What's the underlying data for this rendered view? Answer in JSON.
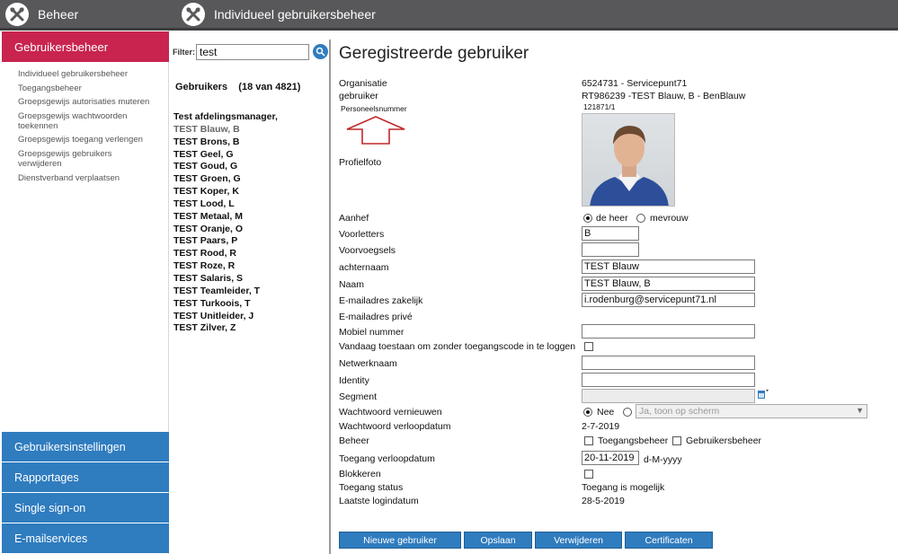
{
  "topbar": {
    "left_title": "Beheer",
    "right_title": "Individueel gebruikersbeheer",
    "icon": "tools-icon"
  },
  "leftnav": {
    "active": "Gebruikersbeheer",
    "subitems": [
      "Individueel gebruikersbeheer",
      "Toegangsbeheer",
      "Groepsgewijs autorisaties muteren",
      "Groepsgewijs wachtwoorden",
      "toekennen",
      "Groepsgewijs toegang verlengen",
      "Groepsgewijs gebruikers",
      "verwijderen",
      "Dienstverband verplaatsen"
    ],
    "sections": [
      "Gebruikersinstellingen",
      "Rapportages",
      "Single sign-on",
      "E-mailservices"
    ]
  },
  "filter": {
    "label": "Filter:",
    "value": "test",
    "button_icon": "search-icon"
  },
  "users": {
    "heading": "Gebruikers    (18 van 4821)",
    "items": [
      "Test afdelingsmanager,",
      "TEST Blauw, B",
      "TEST Brons, B",
      "TEST Geel, G",
      "TEST Goud, G",
      "TEST Groen, G",
      "TEST Koper, K",
      "TEST Lood, L",
      "TEST Metaal, M",
      "TEST Oranje, O",
      "TEST Paars, P",
      "TEST Rood, R",
      "TEST Roze, R",
      "TEST Salaris, S",
      "TEST Teamleider, T",
      "TEST Turkoois, T",
      "TEST Unitleider, J",
      "TEST Zilver, Z"
    ],
    "selected_index": 1
  },
  "main": {
    "title": "Geregistreerde gebruiker",
    "organisatie_label": "Organisatie",
    "organisatie_value": "6524731 - Servicepunt71",
    "gebruiker_label": "gebruiker",
    "gebruiker_value": "RT986239 -TEST Blauw, B  - BenBlauw",
    "personeelsnummer_label": "Personeelsnummer",
    "personeelsnummer_value": "121871/1",
    "profielfoto_label": "Profielfoto",
    "aanhef_label": "Aanhef",
    "aanhef_options": [
      "de heer",
      "mevrouw"
    ],
    "voorletters_label": "Voorletters",
    "voorletters_value": "B",
    "voorvoegsels_label": "Voorvoegsels",
    "voorvoegsels_value": "",
    "achternaam_label": "achternaam",
    "achternaam_value": "TEST Blauw",
    "naam_label": "Naam",
    "naam_value": "TEST Blauw, B",
    "email_zakelijk_label": "E-mailadres zakelijk",
    "email_zakelijk_value": "i.rodenburg@servicepunt71.nl",
    "email_prive_label": "E-mailadres privé",
    "mobiel_label": "Mobiel nummer",
    "mobiel_value": "",
    "vandaag_label": "Vandaag toestaan om zonder toegangscode in te loggen",
    "netwerknaam_label": "Netwerknaam",
    "netwerknaam_value": "",
    "identity_label": "Identity",
    "identity_value": "",
    "segment_label": "Segment",
    "segment_value": "",
    "ww_vernieuwen_label": "Wachtwoord vernieuwen",
    "ww_nee": "Nee",
    "ww_select": "Ja, toon op scherm",
    "ww_verloop_label": "Wachtwoord verloopdatum",
    "ww_verloop_value": "2-7-2019",
    "beheer_label": "Beheer",
    "beheer_opt1": "Toegangsbeheer",
    "beheer_opt2": "Gebruikersbeheer",
    "toegang_verloop_label": "Toegang verloopdatum",
    "toegang_verloop_value": "20-11-2019",
    "toegang_verloop_format": "d-M-yyyy",
    "blokkeren_label": "Blokkeren",
    "toegang_status_label": "Toegang status",
    "toegang_status_value": "Toegang is mogelijk",
    "laatste_login_label": "Laatste logindatum",
    "laatste_login_value": "28-5-2019"
  },
  "buttons": {
    "nieuw": "Nieuwe gebruiker",
    "opslaan": "Opslaan",
    "verwijderen": "Verwijderen",
    "certificaten": "Certificaten"
  },
  "colors": {
    "accent": "#c8244f",
    "nav_blue": "#2f7cbf",
    "topbar": "#58585a",
    "arrow": "#c0282c"
  }
}
